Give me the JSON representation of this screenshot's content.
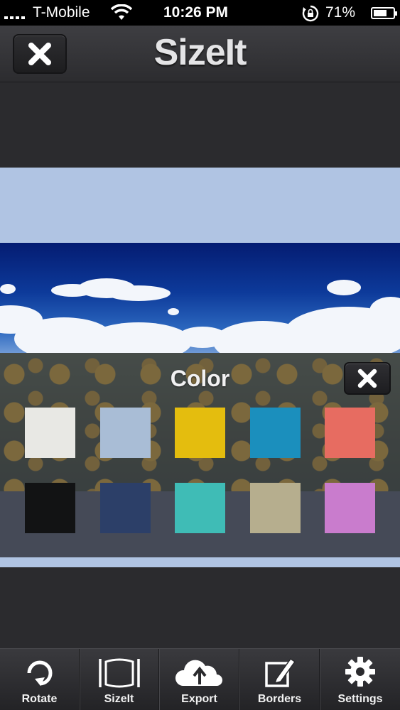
{
  "status_bar": {
    "carrier": "T-Mobile",
    "time": "10:26 PM",
    "battery_percent": "71%",
    "battery_level": 0.71
  },
  "nav": {
    "title": "SizeIt",
    "close_icon": "close-x-icon"
  },
  "image": {
    "border_color": "#b0c4e3",
    "description_icons": [
      "sky",
      "clouds",
      "sunflower-field"
    ]
  },
  "color_panel": {
    "title": "Color",
    "close_icon": "close-x-icon",
    "swatches": [
      {
        "color": "#e8e8e4"
      },
      {
        "color": "#a9bdd6"
      },
      {
        "color": "#e4bd0e"
      },
      {
        "color": "#1b8fbd"
      },
      {
        "color": "#e76c61"
      },
      {
        "color": "#121314"
      },
      {
        "color": "#2c3f68"
      },
      {
        "color": "#3fbcb6"
      },
      {
        "color": "#b6ae8e"
      },
      {
        "color": "#c97ccd"
      }
    ]
  },
  "toolbar": {
    "items": [
      {
        "label": "Rotate",
        "icon": "rotate-icon"
      },
      {
        "label": "SizeIt",
        "icon": "sizeit-frame-icon"
      },
      {
        "label": "Export",
        "icon": "cloud-upload-icon"
      },
      {
        "label": "Borders",
        "icon": "pencil-edit-icon"
      },
      {
        "label": "Settings",
        "icon": "gear-icon"
      }
    ]
  }
}
